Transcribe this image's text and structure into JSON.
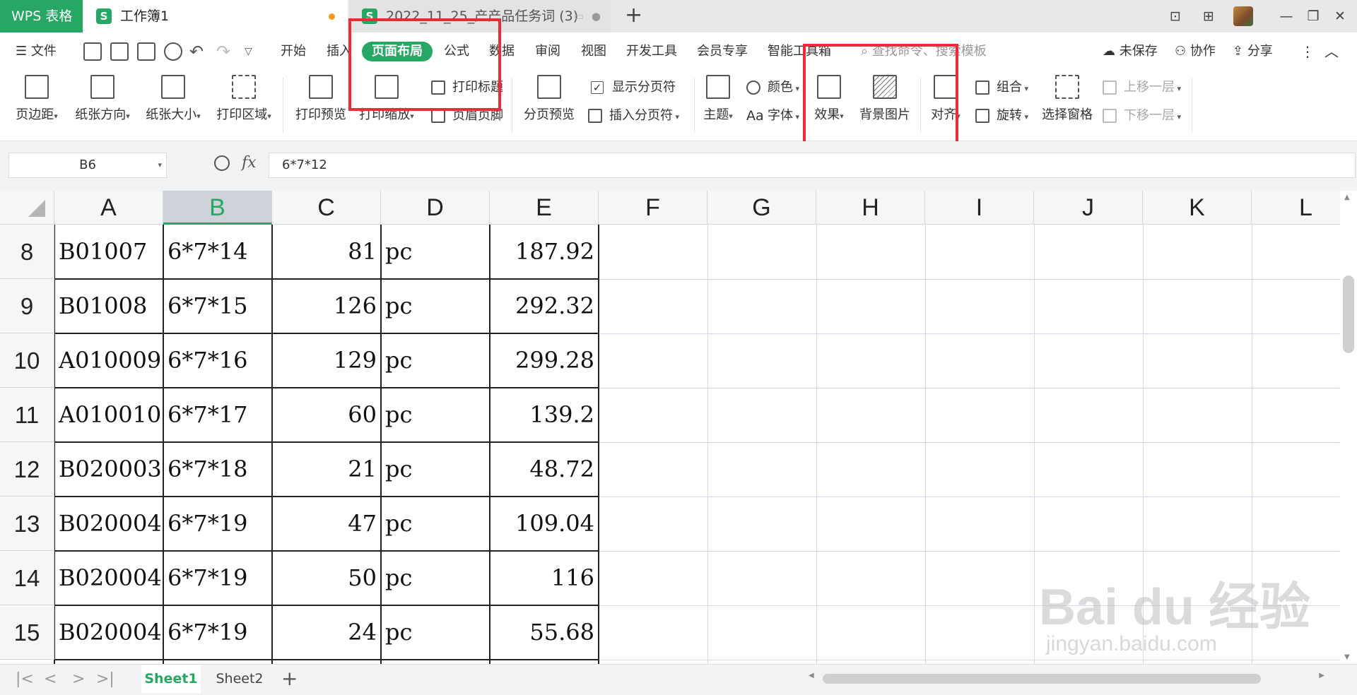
{
  "titlebar": {
    "app_name": "WPS 表格",
    "active_tab": "工作簿1",
    "inactive_tab": "2022_11_25_产产品任务词 (3)",
    "add_tab": "+"
  },
  "menu": {
    "file": "文件",
    "items": [
      "开始",
      "插入",
      "页面布局",
      "公式",
      "数据",
      "审阅",
      "视图",
      "开发工具",
      "会员专享",
      "智能工具箱"
    ],
    "active_item": "页面布局",
    "search_placeholder": "查找命令、搜索模板",
    "unsaved": "未保存",
    "collab": "协作",
    "share": "分享"
  },
  "ribbon": {
    "margins": "页边距",
    "orientation": "纸张方向",
    "size": "纸张大小",
    "print_area": "打印区域",
    "print_preview": "打印预览",
    "print_scale": "打印缩放",
    "print_titles": "打印标题",
    "header_footer": "页眉页脚",
    "page_break_preview": "分页预览",
    "show_page_breaks": "显示分页符",
    "insert_page_break": "插入分页符",
    "theme": "主题",
    "colors": "颜色",
    "fonts": "字体",
    "effects": "效果",
    "background": "背景图片",
    "align": "对齐",
    "group": "组合",
    "rotate": "旋转",
    "selection_pane": "选择窗格",
    "bring_forward": "上移一层",
    "send_backward": "下移一层"
  },
  "formula_bar": {
    "name_box": "B6",
    "formula": "6*7*12"
  },
  "columns": [
    "A",
    "B",
    "C",
    "D",
    "E",
    "F",
    "G",
    "H",
    "I",
    "J",
    "K",
    "L"
  ],
  "selected_column": "B",
  "rows": [
    {
      "num": "8",
      "a": "B01007",
      "b": "6*7*14",
      "c": "81",
      "d": "pc",
      "e": "187.92"
    },
    {
      "num": "9",
      "a": "B01008",
      "b": "6*7*15",
      "c": "126",
      "d": "pc",
      "e": "292.32"
    },
    {
      "num": "10",
      "a": "A010009",
      "b": "6*7*16",
      "c": "129",
      "d": "pc",
      "e": "299.28"
    },
    {
      "num": "11",
      "a": "A010010",
      "b": "6*7*17",
      "c": "60",
      "d": "pc",
      "e": "139.2"
    },
    {
      "num": "12",
      "a": "B020003",
      "b": "6*7*18",
      "c": "21",
      "d": "pc",
      "e": "48.72"
    },
    {
      "num": "13",
      "a": "B020004",
      "b": "6*7*19",
      "c": "47",
      "d": "pc",
      "e": "109.04"
    },
    {
      "num": "14",
      "a": "B020004",
      "b": "6*7*19",
      "c": "50",
      "d": "pc",
      "e": "116"
    },
    {
      "num": "15",
      "a": "B020004",
      "b": "6*7*19",
      "c": "24",
      "d": "pc",
      "e": "55.68"
    }
  ],
  "sheets": [
    "Sheet1",
    "Sheet2"
  ],
  "active_sheet": "Sheet1",
  "watermark": {
    "main": "Bai du 经验",
    "sub": "jingyan.baidu.com"
  },
  "colors": {
    "accent": "#26a764",
    "highlight": "#ec2a3a"
  }
}
